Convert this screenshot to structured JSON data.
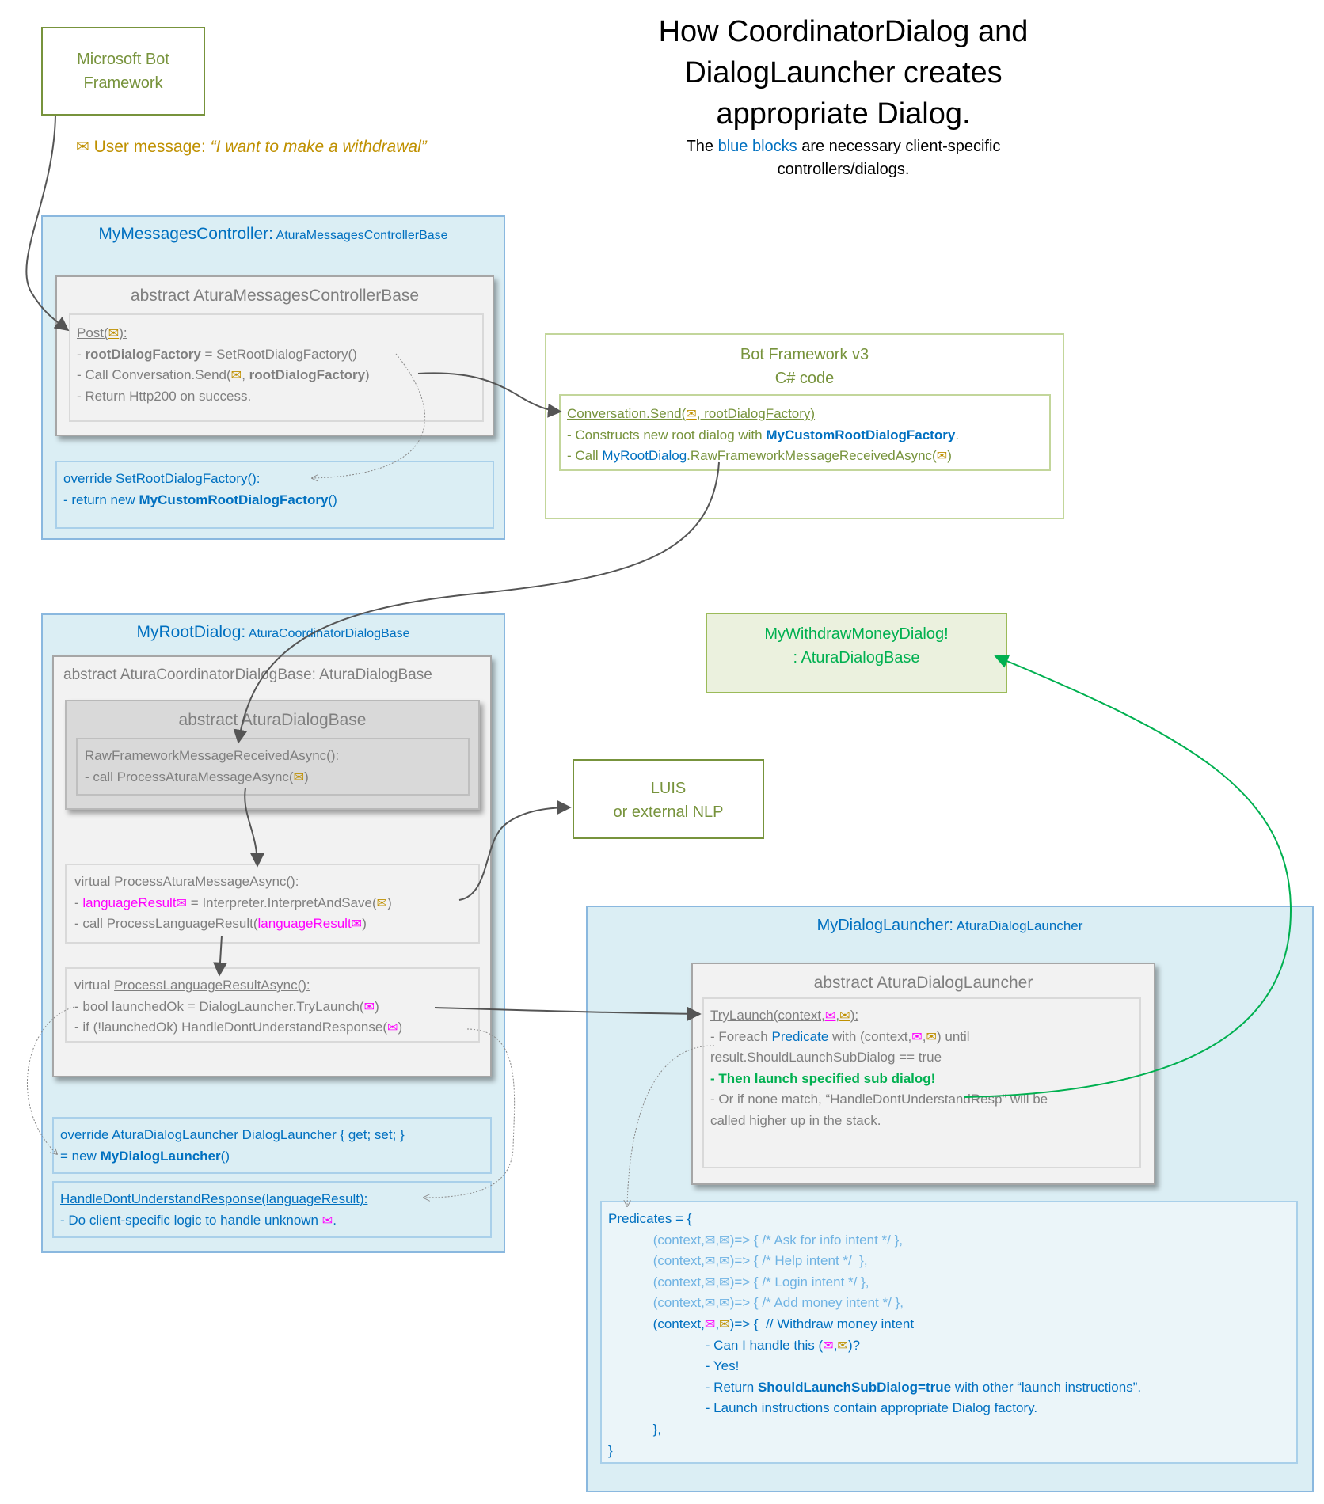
{
  "palette": {
    "gold": "#bf9000",
    "magenta": "#ff00ff",
    "light": "#6fb3e3",
    "brand_blue": "#0070c0",
    "olive": "#77933c",
    "green": "#00b050"
  },
  "title": {
    "lines": [
      "How CoordinatorDialog and",
      "DialogLauncher creates",
      "appropriate Dialog."
    ],
    "subtitle_pre": "The ",
    "subtitle_blue": "blue blocks",
    "subtitle_post": " are necessary client-specific",
    "subtitle_line2": "controllers/dialogs."
  },
  "bot_framework": {
    "line1": "Microsoft Bot",
    "line2": "Framework"
  },
  "user_message": {
    "label": "User message: ",
    "quote": "“I want to make a withdrawal”"
  },
  "messages_controller": {
    "title": "MyMessagesController:",
    "base": " AturaMessagesControllerBase",
    "abstract_title": "abstract AturaMessagesControllerBase",
    "post_lines": [
      [
        {
          "t": "Post(",
          "s": "u"
        },
        {
          "icon": "envelope",
          "color": "gold",
          "s": "u"
        },
        {
          "t": "):",
          "s": "u"
        }
      ],
      [
        {
          "t": "- "
        },
        {
          "t": "rootDialogFactory",
          "s": "b"
        },
        {
          "t": " = SetRootDialogFactory()"
        }
      ],
      [
        {
          "t": "- Call Conversation.Send("
        },
        {
          "icon": "envelope",
          "color": "gold"
        },
        {
          "t": ", "
        },
        {
          "t": "rootDialogFactory",
          "s": "b"
        },
        {
          "t": ")"
        }
      ],
      [
        {
          "t": "- Return Http200 on success."
        }
      ]
    ],
    "override_lines": [
      [
        {
          "t": "override SetRootDialogFactory():",
          "s": "u"
        }
      ],
      [
        {
          "t": "- return new "
        },
        {
          "t": "MyCustomRootDialogFactory",
          "s": "b"
        },
        {
          "t": "()"
        }
      ]
    ]
  },
  "bot_framework_v3": {
    "line1": "Bot Framework v3",
    "line2": "C# code",
    "lines": [
      [
        {
          "t": "Conversation.Send(",
          "s": "u"
        },
        {
          "icon": "envelope",
          "color": "gold",
          "s": "u"
        },
        {
          "t": ", rootDialogFactory)",
          "s": "u"
        }
      ],
      [
        {
          "t": "- Constructs new root dialog with "
        },
        {
          "t": "MyCustomRootDialogFactory",
          "s": "b blue"
        },
        {
          "t": "."
        }
      ],
      [
        {
          "t": "- Call "
        },
        {
          "t": "MyRootDialog",
          "s": "blue"
        },
        {
          "t": ".RawFrameworkMessageReceivedAsync("
        },
        {
          "icon": "envelope",
          "color": "gold"
        },
        {
          "t": ")"
        }
      ]
    ]
  },
  "root_dialog": {
    "title": "MyRootDialog:",
    "base": " AturaCoordinatorDialogBase",
    "coordinator_title": "abstract AturaCoordinatorDialogBase: AturaDialogBase",
    "dialog_base_title": "abstract AturaDialogBase",
    "raw_lines": [
      [
        {
          "t": "RawFrameworkMessageReceivedAsync():",
          "s": "u"
        }
      ],
      [
        {
          "t": "- call ProcessAturaMessageAsync("
        },
        {
          "icon": "envelope",
          "color": "gold"
        },
        {
          "t": ")"
        }
      ]
    ],
    "process_message_lines": [
      [
        {
          "t": "virtual "
        },
        {
          "t": "ProcessAturaMessageAsync():",
          "s": "u"
        }
      ],
      [
        {
          "t": "- "
        },
        {
          "t": "languageResult",
          "s": "mag"
        },
        {
          "icon": "envelope",
          "color": "magenta"
        },
        {
          "t": " = Interpreter.InterpretAndSave("
        },
        {
          "icon": "envelope",
          "color": "gold"
        },
        {
          "t": ")"
        }
      ],
      [
        {
          "t": "- call ProcessLanguageResult("
        },
        {
          "t": "languageResult",
          "s": "mag"
        },
        {
          "icon": "envelope",
          "color": "magenta"
        },
        {
          "t": ")"
        }
      ]
    ],
    "process_language_lines": [
      [
        {
          "t": "virtual "
        },
        {
          "t": "ProcessLanguageResultAsync():",
          "s": "u"
        }
      ],
      [
        {
          "t": "- bool launchedOk = DialogLauncher.TryLaunch("
        },
        {
          "icon": "envelope",
          "color": "magenta"
        },
        {
          "t": ")"
        }
      ],
      [
        {
          "t": "- if (!launchedOk) HandleDontUnderstandResponse("
        },
        {
          "icon": "envelope",
          "color": "magenta"
        },
        {
          "t": ")"
        }
      ]
    ],
    "override_launcher_lines": [
      [
        {
          "t": "override AturaDialogLauncher DialogLauncher { get; set; }"
        }
      ],
      [
        {
          "t": "= new "
        },
        {
          "t": "MyDialogLauncher",
          "s": "b"
        },
        {
          "t": "()"
        }
      ]
    ],
    "handle_lines": [
      [
        {
          "t": "HandleDontUnderstandResponse(languageResult):",
          "s": "u"
        }
      ],
      [
        {
          "t": "- Do client-specific logic to handle unknown "
        },
        {
          "icon": "envelope",
          "color": "magenta"
        },
        {
          "t": "."
        }
      ]
    ]
  },
  "withdraw_dialog": {
    "line1": "MyWithdrawMoneyDialog!",
    "line2": ": AturaDialogBase"
  },
  "luis": {
    "line1": "LUIS",
    "line2": "or external NLP"
  },
  "dialog_launcher": {
    "title": "MyDialogLauncher:",
    "base": " AturaDialogLauncher",
    "abstract_title": "abstract AturaDialogLauncher",
    "try_lines": [
      [
        {
          "t": "TryLaunch(context,",
          "s": "u"
        },
        {
          "icon": "envelope",
          "color": "magenta",
          "s": "u"
        },
        {
          "t": ",",
          "s": "u"
        },
        {
          "icon": "envelope",
          "color": "gold",
          "s": "u"
        },
        {
          "t": "):",
          "s": "u"
        }
      ],
      [
        {
          "t": "- Foreach "
        },
        {
          "t": "Predicate",
          "s": "blue"
        },
        {
          "t": " with (context,"
        },
        {
          "icon": "envelope",
          "color": "magenta"
        },
        {
          "t": ","
        },
        {
          "icon": "envelope",
          "color": "gold"
        },
        {
          "t": ") until"
        }
      ],
      [
        {
          "t": "result.ShouldLaunchSubDialog == true"
        }
      ],
      [
        {
          "t": " "
        }
      ],
      [
        {
          "t": "- Then launch specified sub dialog!",
          "s": "b grn"
        }
      ],
      [
        {
          "t": "- Or if none match, “HandleDontUnderstandResp” will be"
        }
      ],
      [
        {
          "t": "called higher up in the stack."
        }
      ]
    ],
    "predicate_lines": [
      [
        {
          "t": "Predicates = {"
        }
      ],
      [
        {
          "t": "            "
        },
        {
          "t": "(context,",
          "s": "light"
        },
        {
          "icon": "envelope",
          "color": "light"
        },
        {
          "t": ",",
          "s": "light"
        },
        {
          "icon": "envelope",
          "color": "light"
        },
        {
          "t": ")=> { /* Ask for info intent */ },",
          "s": "light"
        }
      ],
      [
        {
          "t": "            "
        },
        {
          "t": "(context,",
          "s": "light"
        },
        {
          "icon": "envelope",
          "color": "light"
        },
        {
          "t": ",",
          "s": "light"
        },
        {
          "icon": "envelope",
          "color": "light"
        },
        {
          "t": ")=> { /* Help intent */  },",
          "s": "light"
        }
      ],
      [
        {
          "t": "            "
        },
        {
          "t": "(context,",
          "s": "light"
        },
        {
          "icon": "envelope",
          "color": "light"
        },
        {
          "t": ",",
          "s": "light"
        },
        {
          "icon": "envelope",
          "color": "light"
        },
        {
          "t": ")=> { /* Login intent */ },",
          "s": "light"
        }
      ],
      [
        {
          "t": "            "
        },
        {
          "t": "(context,",
          "s": "light"
        },
        {
          "icon": "envelope",
          "color": "light"
        },
        {
          "t": ",",
          "s": "light"
        },
        {
          "icon": "envelope",
          "color": "light"
        },
        {
          "t": ")=> { /* Add money intent */ },",
          "s": "light"
        }
      ],
      [
        {
          "t": "            (context,"
        },
        {
          "icon": "envelope",
          "color": "magenta"
        },
        {
          "t": ","
        },
        {
          "icon": "envelope",
          "color": "gold"
        },
        {
          "t": ")=> {  // Withdraw money intent"
        }
      ],
      [
        {
          "t": "                          - Can I handle this ("
        },
        {
          "icon": "envelope",
          "color": "magenta"
        },
        {
          "t": ","
        },
        {
          "icon": "envelope",
          "color": "gold"
        },
        {
          "t": ")?"
        }
      ],
      [
        {
          "t": "                          - Yes!"
        }
      ],
      [
        {
          "t": "                          - Return "
        },
        {
          "t": "ShouldLaunchSubDialog=true",
          "s": "b"
        },
        {
          "t": " with other “launch instructions”."
        }
      ],
      [
        {
          "t": "                          - Launch instructions contain appropriate Dialog factory."
        }
      ],
      [
        {
          "t": "            },"
        }
      ],
      [
        {
          "t": "}"
        }
      ]
    ]
  }
}
